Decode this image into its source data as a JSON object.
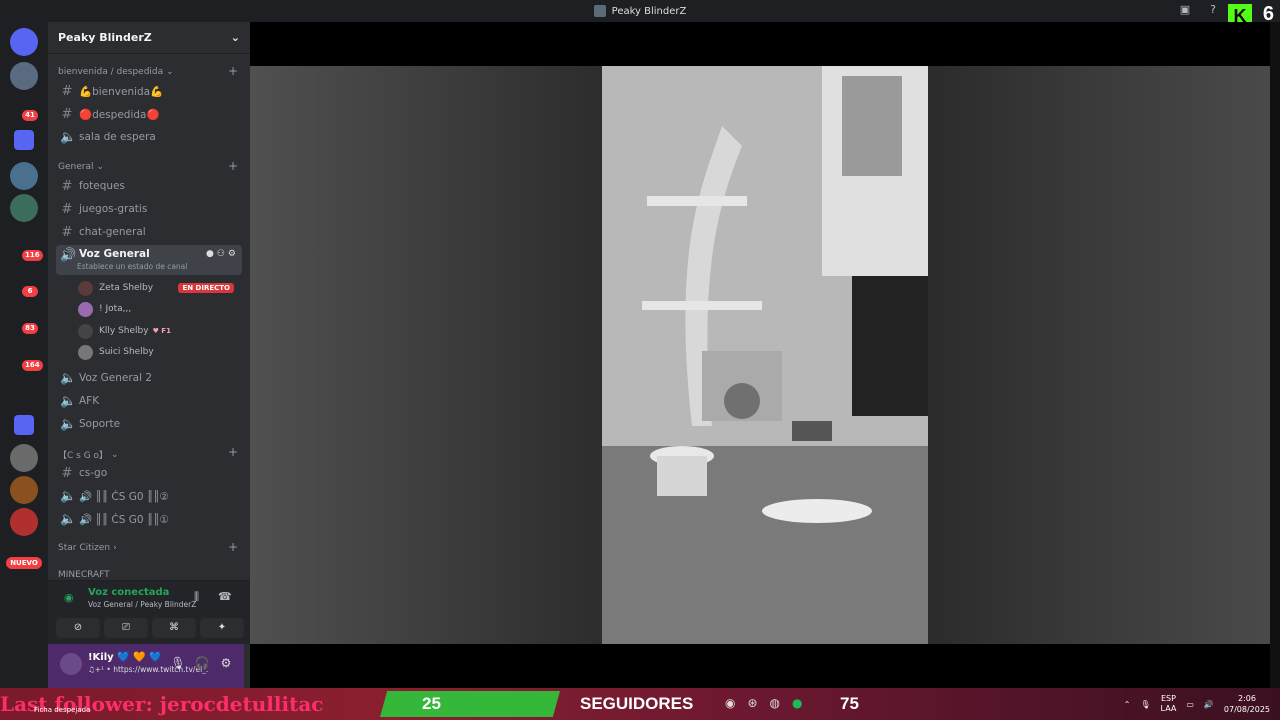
{
  "window": {
    "title": "Peaky BlinderZ"
  },
  "server_rail": {
    "badges": [
      "41",
      "116",
      "6",
      "83",
      "164"
    ],
    "nuevo": "NUEVO"
  },
  "server": {
    "name": "Peaky BlinderZ",
    "categories": [
      {
        "label": "bienvenida / despedida"
      },
      {
        "label": "General"
      },
      {
        "label": "【C s  G o】"
      },
      {
        "label": "Star Citizen"
      },
      {
        "label": "MINECRAFT"
      }
    ],
    "channels": {
      "bienvenida": "💪bienvenida💪",
      "despedida": "🔴despedida🔴",
      "sala_espera": "sala de espera",
      "foteques": "foteques",
      "juegos_gratis": "juegos-gratis",
      "chat_general": "chat-general",
      "voz_general": "Voz General",
      "voz_general_sub": "Establece un estado de canal",
      "voz_general_2": "Voz General 2",
      "afk": "AFK",
      "soporte": "Soporte",
      "cs_go": "cs-go",
      "cs_voice_1": "🔊 ║║ ĊS G0 ║║②",
      "cs_voice_2": "🔊 ║║ ĊS G0 ║║①"
    },
    "voice_users": [
      {
        "name": "Zeta Shelby",
        "tag": "EN DIRECTO"
      },
      {
        "name": "! Jota,,,",
        "tag": ""
      },
      {
        "name": "Klly Shelby",
        "tag": "♥ F1"
      },
      {
        "name": "Suici Shelby",
        "tag": ""
      }
    ]
  },
  "voice_panel": {
    "status": "Voz conectada",
    "location": "Voz General / Peaky BlinderZ"
  },
  "user_panel": {
    "name": "!Kily 💙 🧡 💙",
    "status": "♫+¹ • https://www.twitch.tv/el_..."
  },
  "overlay": {
    "latest_follower": "Last follower: jerocdetullitac",
    "latest_follower_sub": "Ficha despejada",
    "goal_current": "25",
    "goal_label": "SEGUIDORES",
    "goal_target": "75"
  },
  "taskbar": {
    "lang_top": "ESP",
    "lang_bottom": "LAA",
    "time": "2:06",
    "date": "07/08/2025"
  },
  "colors": {
    "accent_green": "#35b83a",
    "live_red": "#da373c",
    "voice_connected": "#23a55a"
  }
}
